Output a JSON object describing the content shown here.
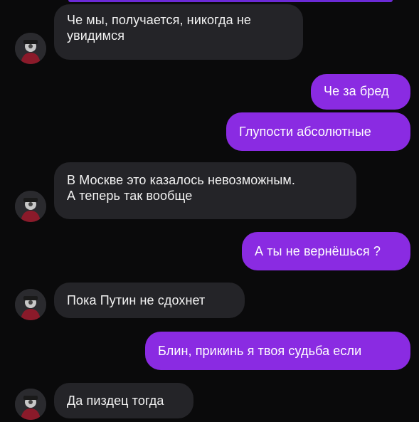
{
  "chat": {
    "messages": [
      {
        "side": "incoming",
        "text": "Че мы, получается, никогда не\nувидимся",
        "avatar": "user-avatar"
      },
      {
        "side": "outgoing",
        "text": "Че за бред"
      },
      {
        "side": "outgoing",
        "text": "Глупости абсолютные"
      },
      {
        "side": "incoming",
        "text": "В Москве это казалось невозможным.\nА теперь так вообще",
        "avatar": "user-avatar"
      },
      {
        "side": "outgoing",
        "text": "А ты не вернёшься ?"
      },
      {
        "side": "incoming",
        "text": "Пока Путин не сдохнет",
        "avatar": "user-avatar"
      },
      {
        "side": "outgoing",
        "text": "Блин, прикинь я твоя судьба если"
      },
      {
        "side": "incoming",
        "text": "Да пиздец тогда",
        "avatar": "user-avatar"
      }
    ]
  },
  "colors": {
    "background": "#0a0a0b",
    "incoming_bubble": "#242428",
    "outgoing_bubble": "#8a2be2",
    "text": "#f2f2f2"
  }
}
